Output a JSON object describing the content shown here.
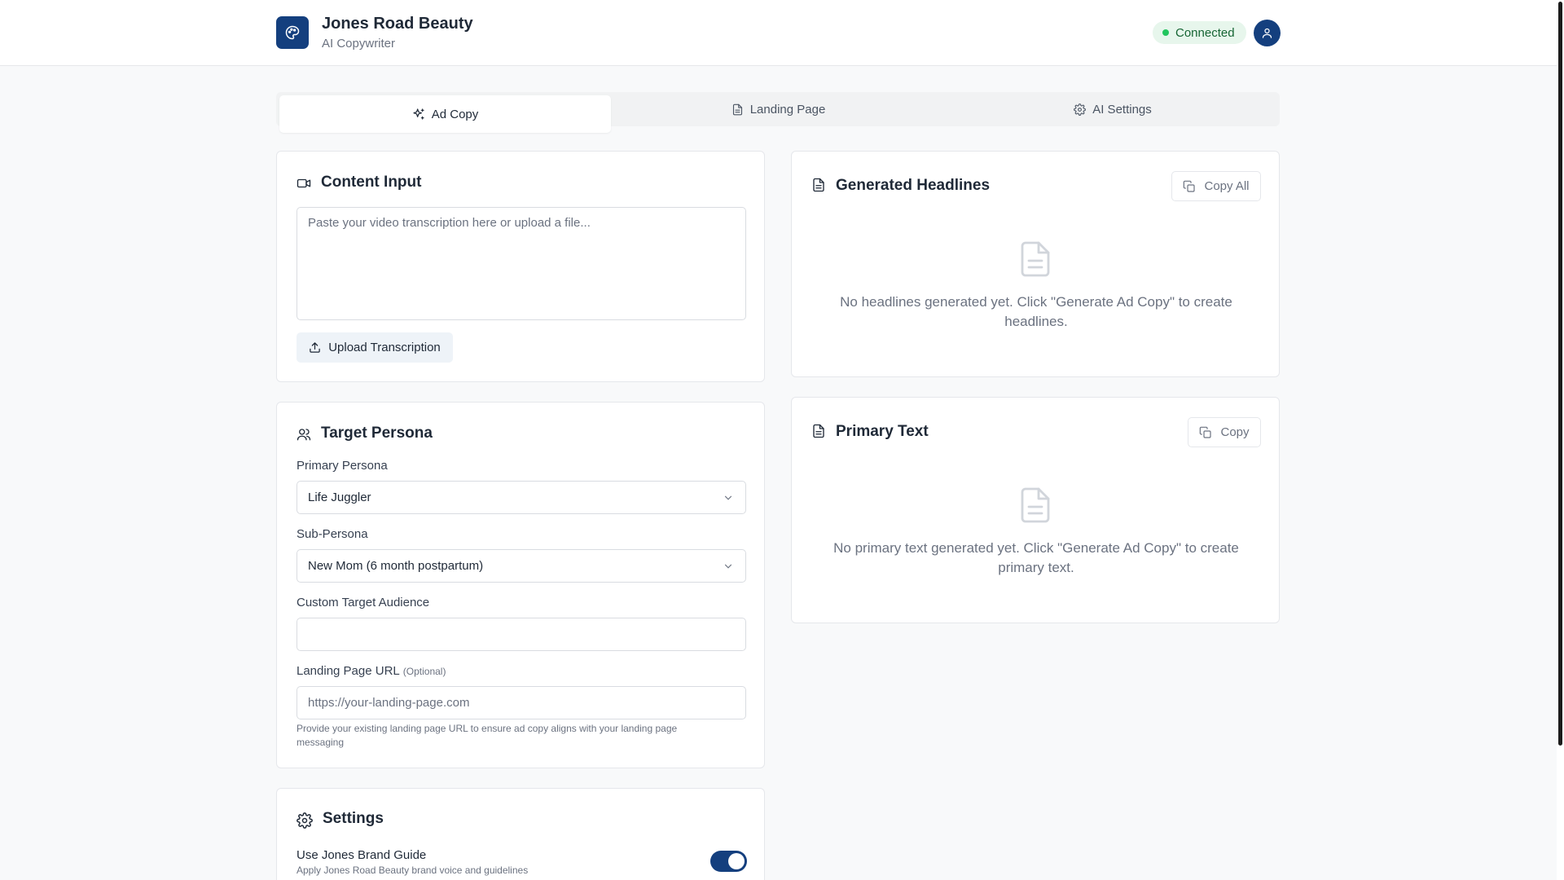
{
  "header": {
    "brand_title": "Jones Road Beauty",
    "brand_subtitle": "AI Copywriter",
    "status": "Connected"
  },
  "tabs": [
    {
      "label": "Ad Copy",
      "icon": "sparkles-icon",
      "active": true
    },
    {
      "label": "Landing Page",
      "icon": "document-icon",
      "active": false
    },
    {
      "label": "AI Settings",
      "icon": "gear-icon",
      "active": false
    }
  ],
  "content_input": {
    "title": "Content Input",
    "textarea_placeholder": "Paste your video transcription here or upload a file...",
    "textarea_value": "",
    "upload_label": "Upload Transcription"
  },
  "target_persona": {
    "title": "Target Persona",
    "primary_label": "Primary Persona",
    "primary_value": "Life Juggler",
    "sub_label": "Sub-Persona",
    "sub_value": "New Mom (6 month postpartum)",
    "custom_label": "Custom Target Audience",
    "custom_value": "",
    "url_label": "Landing Page URL",
    "url_optional": "(Optional)",
    "url_placeholder": "https://your-landing-page.com",
    "url_helper": "Provide your existing landing page URL to ensure ad copy aligns with your landing page messaging"
  },
  "settings": {
    "title": "Settings",
    "brand_guide_label": "Use Jones Brand Guide",
    "brand_guide_desc": "Apply Jones Road Beauty brand voice and guidelines",
    "brand_guide_enabled": true
  },
  "headlines": {
    "title": "Generated Headlines",
    "copy_label": "Copy All",
    "empty_text": "No headlines generated yet. Click \"Generate Ad Copy\" to create headlines."
  },
  "primary_text": {
    "title": "Primary Text",
    "copy_label": "Copy",
    "empty_text": "No primary text generated yet. Click \"Generate Ad Copy\" to create primary text."
  },
  "colors": {
    "brand": "#143f7e",
    "connected_bg": "#e7f6ec",
    "connected_dot": "#22c55e",
    "background": "#f8f9fa"
  }
}
